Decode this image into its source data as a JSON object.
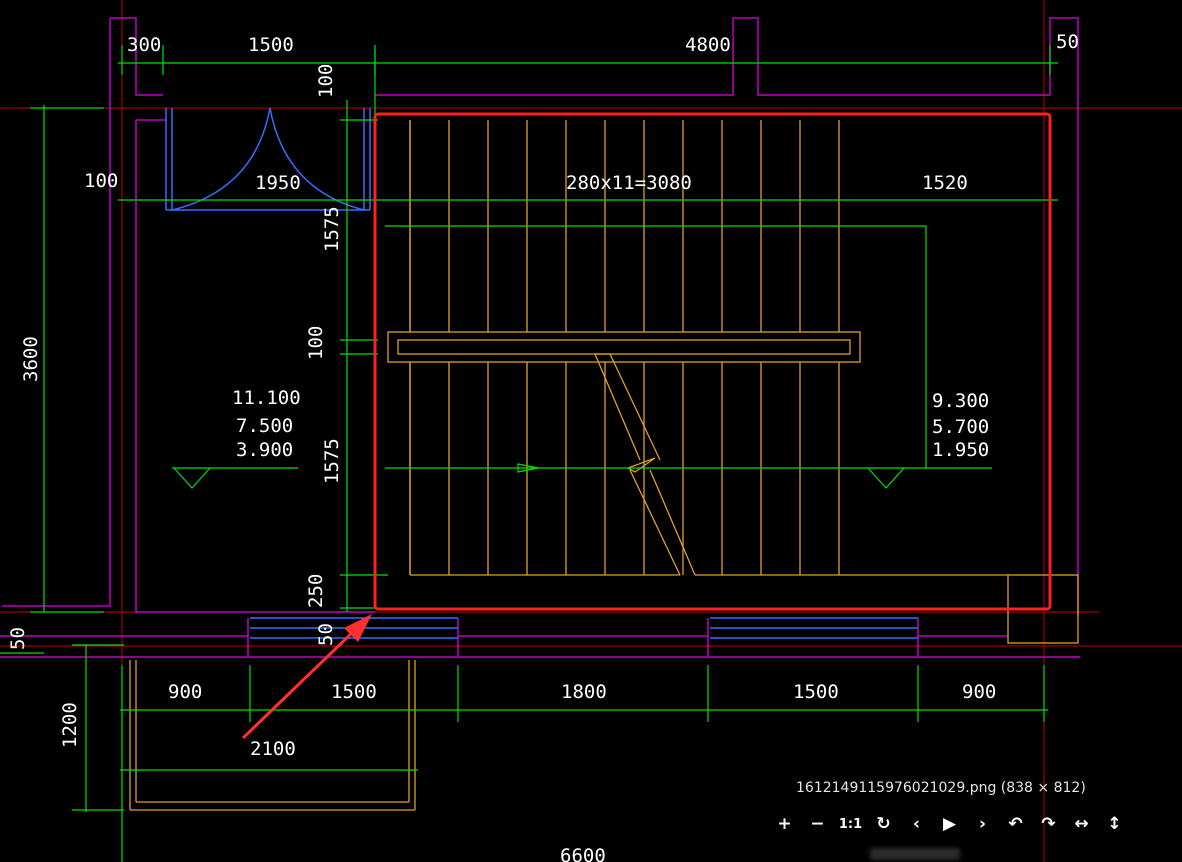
{
  "drawing": {
    "dims_top": [
      "300",
      "1500",
      "4800",
      "50"
    ],
    "dim_100_top": "100",
    "dim_100_left": "100",
    "dim_1950": "1950",
    "dim_steps": "280x11=3080",
    "dim_1520": "1520",
    "dim_3600": "3600",
    "dim_1575_a": "1575",
    "dim_100_mid": "100",
    "dim_1575_b": "1575",
    "dim_250": "250",
    "dim_50_a": "50",
    "dim_50_b": "50",
    "elev_left": [
      "11.100",
      "7.500",
      "3.900"
    ],
    "elev_right": [
      "9.300",
      "5.700",
      "1.950"
    ],
    "dims_bottom": [
      "900",
      "1500",
      "1800",
      "1500",
      "900"
    ],
    "dim_1200": "1200",
    "dim_2100": "2100",
    "dim_6600": "6600"
  },
  "viewer": {
    "caption": "1612149115976021029.png (838 × 812)",
    "toolbar": [
      {
        "name": "zoom-in-button",
        "glyph": "+"
      },
      {
        "name": "zoom-out-button",
        "glyph": "−"
      },
      {
        "name": "actual-size-button",
        "glyph": "1:1"
      },
      {
        "name": "refresh-button",
        "glyph": "↻"
      },
      {
        "name": "previous-button",
        "glyph": "‹"
      },
      {
        "name": "play-button",
        "glyph": "▶"
      },
      {
        "name": "next-button",
        "glyph": "›"
      },
      {
        "name": "rotate-left-button",
        "glyph": "↶"
      },
      {
        "name": "rotate-right-button",
        "glyph": "↷"
      },
      {
        "name": "flip-horizontal-button",
        "glyph": "↔"
      },
      {
        "name": "flip-vertical-button",
        "glyph": "↕"
      }
    ]
  },
  "colors": {
    "background": "#000000",
    "dimension_line": "#00e000",
    "wall": "#c000c0",
    "stair": "#e0a020",
    "door": "#3070ff",
    "axis": "#c00000",
    "highlight": "#ff2020"
  }
}
